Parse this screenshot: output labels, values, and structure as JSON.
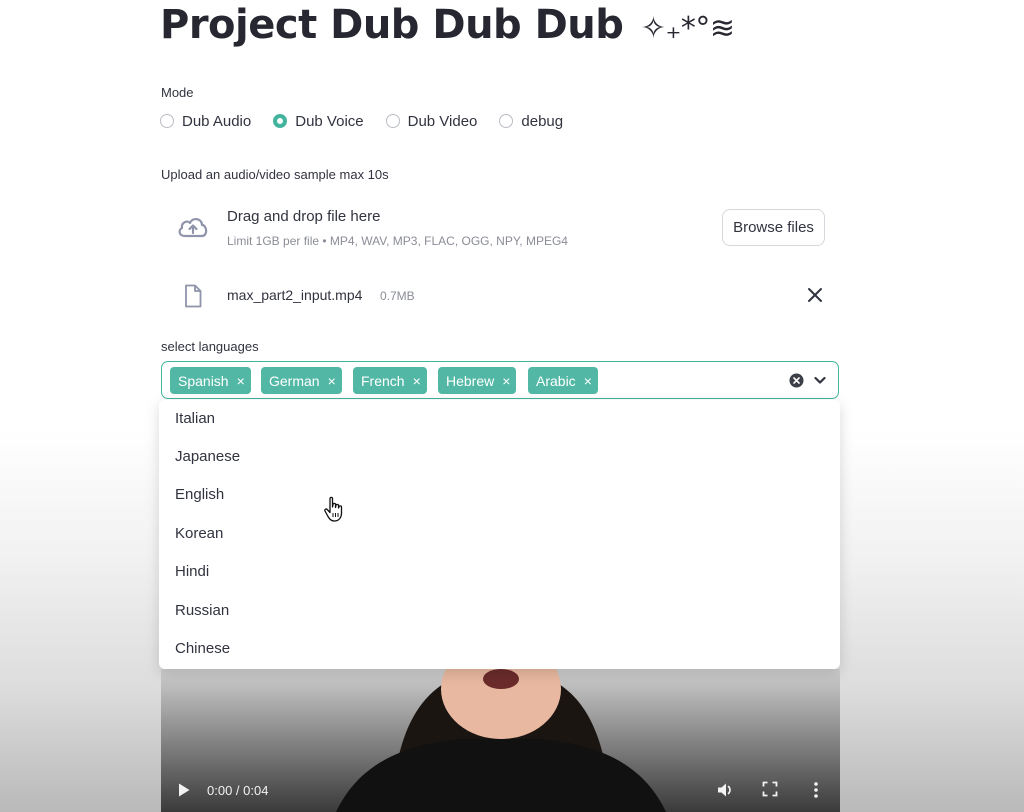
{
  "app": {
    "title": "Project Dub Dub Dub",
    "title_decoration": "✧₊*°≋"
  },
  "mode": {
    "label": "Mode",
    "options": [
      {
        "label": "Dub Audio",
        "selected": false
      },
      {
        "label": "Dub Voice",
        "selected": true
      },
      {
        "label": "Dub Video",
        "selected": false
      },
      {
        "label": "debug",
        "selected": false
      }
    ]
  },
  "upload": {
    "label": "Upload an audio/video sample max 10s",
    "drag_text": "Drag and drop file here",
    "limit_text": "Limit 1GB per file • MP4, WAV, MP3, FLAC, OGG, NPY, MPEG4",
    "browse_label": "Browse files",
    "file": {
      "name": "max_part2_input.mp4",
      "size": "0.7MB"
    }
  },
  "languages": {
    "label": "select languages",
    "selected": [
      "Spanish",
      "German",
      "French",
      "Hebrew",
      "Arabic"
    ],
    "tag_remove_glyph": "×",
    "options": [
      "Italian",
      "Japanese",
      "English",
      "Korean",
      "Hindi",
      "Russian",
      "Chinese"
    ]
  },
  "video": {
    "time": "0:00 / 0:04"
  },
  "colors": {
    "accent": "#42b39c",
    "tag_bg": "#52b8a5",
    "text": "#31333f"
  }
}
